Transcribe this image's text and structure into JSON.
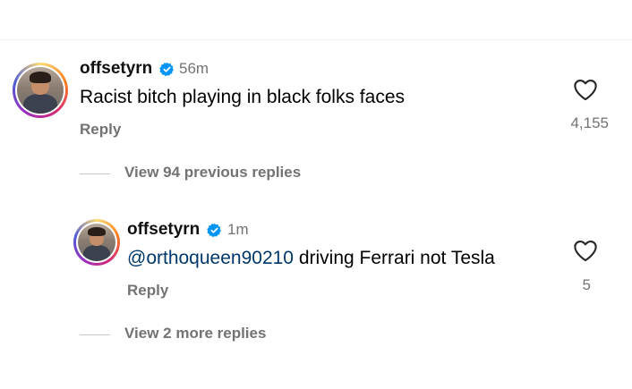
{
  "comment": {
    "username": "offsetyrn",
    "verified_icon": "verified-badge-icon",
    "time": "56m",
    "text": "Racist bitch playing in black folks faces",
    "reply_label": "Reply",
    "likes": "4,155",
    "like_icon": "heart-icon"
  },
  "view_previous": {
    "label": "View 94 previous replies"
  },
  "reply": {
    "username": "offsetyrn",
    "verified_icon": "verified-badge-icon",
    "time": "1m",
    "mention": "@orthoqueen90210",
    "text": " driving Ferrari not Tesla",
    "reply_label": "Reply",
    "likes": "5",
    "like_icon": "heart-icon"
  },
  "view_more": {
    "label": "View 2 more replies"
  },
  "colors": {
    "verified_blue": "#0095f6",
    "secondary_text": "#737373",
    "mention": "#00376b"
  }
}
